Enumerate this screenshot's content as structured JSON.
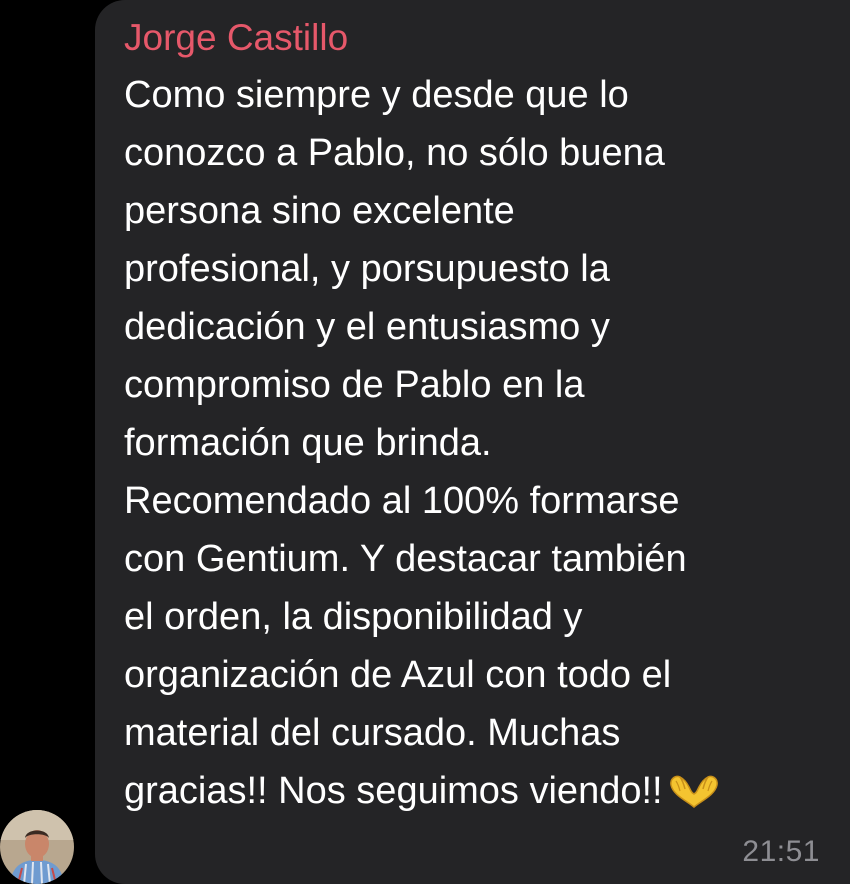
{
  "message": {
    "sender": "Jorge Castillo",
    "lines": [
      "Como siempre y desde que lo",
      "conozco a Pablo, no sólo buena",
      "persona sino excelente",
      "profesional, y porsupuesto la",
      "dedicación y el entusiasmo y",
      "compromiso de Pablo en la",
      "formación que brinda.",
      "Recomendado al 100% formarse",
      "con Gentium. Y destacar también",
      "el orden, la disponibilidad y",
      "organización de Azul con todo el",
      "material del cursado. Muchas",
      "gracias!! Nos seguimos viendo!!"
    ],
    "emoji": "heart-hands-icon",
    "time": "21:51"
  },
  "colors": {
    "background": "#000000",
    "bubble": "#242426",
    "sender_name": "#e6586a",
    "text": "#ffffff",
    "timestamp": "#8e8e93"
  }
}
